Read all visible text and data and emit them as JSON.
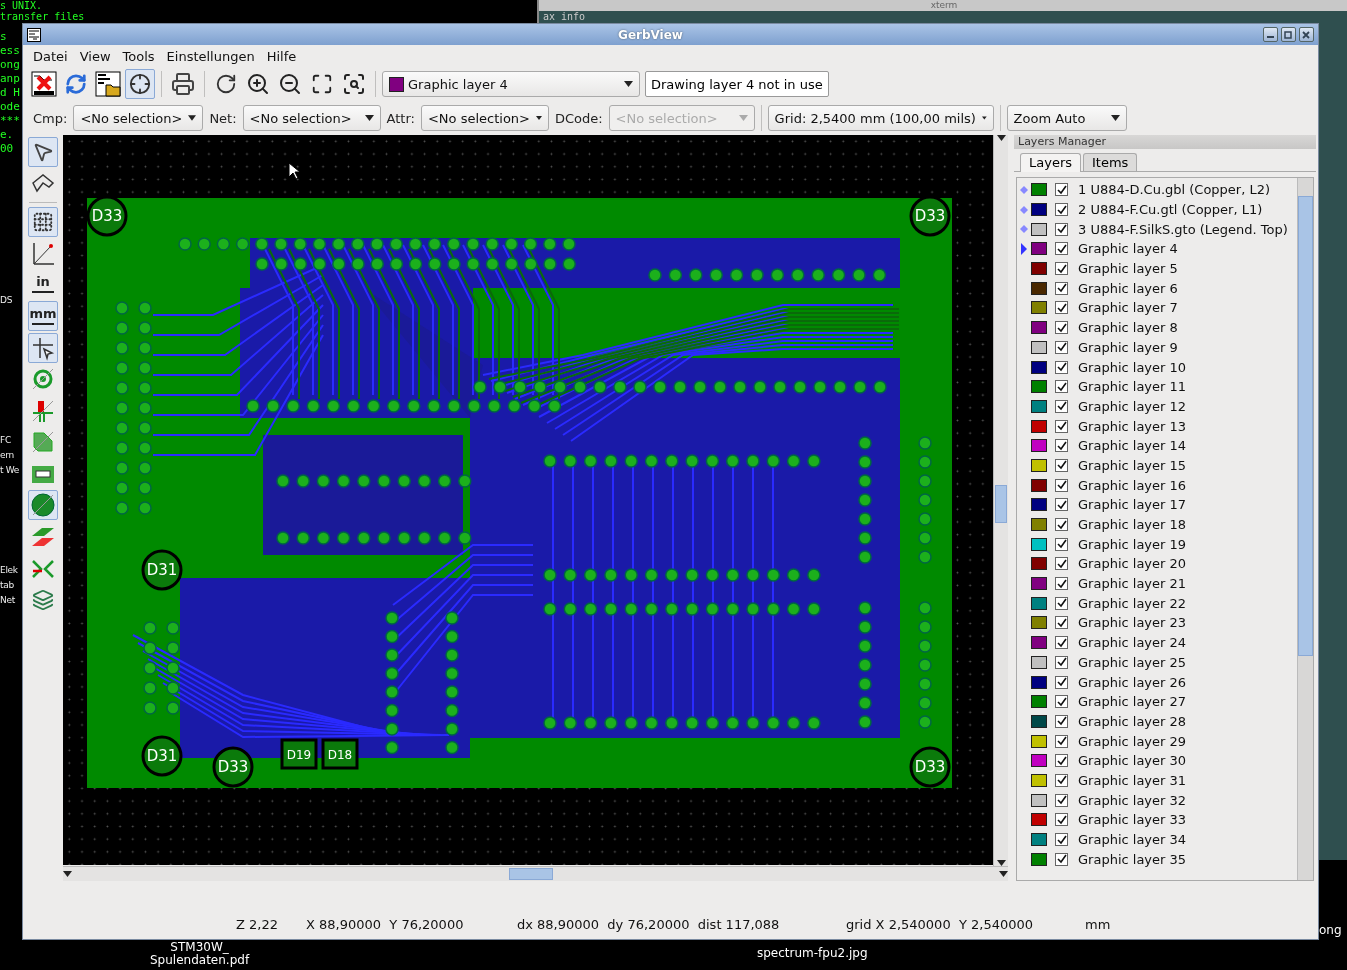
{
  "desktop": {
    "terminal_top": [
      "s UNIX.",
      "transfer files"
    ],
    "terminal_lines": [
      "s",
      "ess",
      "ong",
      "anp",
      "d H",
      "ode",
      "***",
      "e.",
      "00"
    ],
    "side_texts": [
      "DS",
      "FC",
      "ern",
      "t We",
      "Elek",
      "tab",
      "Net"
    ],
    "xterm_title": "xterm",
    "xterm_line": "ax info",
    "icons": [
      {
        "label": "STM30W_",
        "label_2": "Spulendaten.pdf"
      },
      {
        "label": "spectrum-fpu2.jpg"
      }
    ],
    "edge_text": "ong"
  },
  "window": {
    "title": "GerbView"
  },
  "menu": [
    "Datei",
    "View",
    "Tools",
    "Einstellungen",
    "Hilfe"
  ],
  "main_toolbar": {
    "tools": [
      {
        "toggled": false
      },
      {
        "toggled": false
      },
      {
        "toggled": false
      },
      {
        "toggled": true
      },
      {
        "toggled": false
      },
      {
        "toggled": false
      },
      {
        "toggled": false
      },
      {
        "toggled": false
      },
      {
        "toggled": false
      },
      {
        "toggled": false
      }
    ],
    "layer_select": {
      "value": "Graphic layer 4",
      "color": "#800080"
    },
    "layer_status": "Drawing layer 4 not in use"
  },
  "filter_toolbar": {
    "filters": [
      {
        "label": "Cmp:",
        "value": "<No selection>",
        "disabled": false
      },
      {
        "label": "Net:",
        "value": "<No selection>",
        "disabled": false
      },
      {
        "label": "Attr:",
        "value": "<No selection>",
        "disabled": false
      },
      {
        "label": "DCode:",
        "value": "<No selection>",
        "disabled": true
      }
    ],
    "grid": "Grid: 2,5400 mm (100,00 mils)",
    "zoom": "Zoom Auto"
  },
  "left_toolbar": [
    {
      "toggled": true
    },
    {
      "toggled": false
    },
    {
      "toggled": true
    },
    {
      "toggled": false
    },
    {
      "toggled": false,
      "label": "in"
    },
    {
      "toggled": true,
      "label": "mm"
    },
    {
      "toggled": true
    },
    {
      "toggled": false
    },
    {
      "toggled": false
    },
    {
      "toggled": false
    },
    {
      "toggled": false
    },
    {
      "toggled": true
    },
    {
      "toggled": false
    },
    {
      "toggled": false
    },
    {
      "toggled": false
    }
  ],
  "board": {
    "labels": [
      "D33",
      "D33",
      "D31",
      "D31",
      "D19",
      "D18",
      "D33",
      "D33"
    ]
  },
  "layers_manager": {
    "title": "Layers Manager",
    "tabs": [
      {
        "label": "Layers",
        "selected": true
      },
      {
        "label": "Items",
        "selected": false
      }
    ],
    "layers": [
      {
        "name": "1 U884-D.Cu.gbl (Copper, L2)",
        "color": "#008000",
        "checked": true,
        "loaded": true,
        "selected": false
      },
      {
        "name": "2 U884-F.Cu.gtl (Copper, L1)",
        "color": "#000080",
        "checked": true,
        "loaded": true,
        "selected": false
      },
      {
        "name": "3 U884-F.SilkS.gto (Legend. Top)",
        "color": "#c0c0c0",
        "checked": true,
        "loaded": true,
        "selected": false
      },
      {
        "name": "Graphic layer 4",
        "color": "#800080",
        "checked": true,
        "loaded": false,
        "selected": true
      },
      {
        "name": "Graphic layer 5",
        "color": "#800000",
        "checked": true,
        "loaded": false,
        "selected": false
      },
      {
        "name": "Graphic layer 6",
        "color": "#4a2800",
        "checked": true,
        "loaded": false,
        "selected": false
      },
      {
        "name": "Graphic layer 7",
        "color": "#808000",
        "checked": true,
        "loaded": false,
        "selected": false
      },
      {
        "name": "Graphic layer 8",
        "color": "#800080",
        "checked": true,
        "loaded": false,
        "selected": false
      },
      {
        "name": "Graphic layer 9",
        "color": "#c0c0c0",
        "checked": true,
        "loaded": false,
        "selected": false
      },
      {
        "name": "Graphic layer 10",
        "color": "#000080",
        "checked": true,
        "loaded": false,
        "selected": false
      },
      {
        "name": "Graphic layer 11",
        "color": "#008000",
        "checked": true,
        "loaded": false,
        "selected": false
      },
      {
        "name": "Graphic layer 12",
        "color": "#008080",
        "checked": true,
        "loaded": false,
        "selected": false
      },
      {
        "name": "Graphic layer 13",
        "color": "#c00000",
        "checked": true,
        "loaded": false,
        "selected": false
      },
      {
        "name": "Graphic layer 14",
        "color": "#c000c0",
        "checked": true,
        "loaded": false,
        "selected": false
      },
      {
        "name": "Graphic layer 15",
        "color": "#c0c000",
        "checked": true,
        "loaded": false,
        "selected": false
      },
      {
        "name": "Graphic layer 16",
        "color": "#800000",
        "checked": true,
        "loaded": false,
        "selected": false
      },
      {
        "name": "Graphic layer 17",
        "color": "#000080",
        "checked": true,
        "loaded": false,
        "selected": false
      },
      {
        "name": "Graphic layer 18",
        "color": "#808000",
        "checked": true,
        "loaded": false,
        "selected": false
      },
      {
        "name": "Graphic layer 19",
        "color": "#00c0c0",
        "checked": true,
        "loaded": false,
        "selected": false
      },
      {
        "name": "Graphic layer 20",
        "color": "#800000",
        "checked": true,
        "loaded": false,
        "selected": false
      },
      {
        "name": "Graphic layer 21",
        "color": "#800080",
        "checked": true,
        "loaded": false,
        "selected": false
      },
      {
        "name": "Graphic layer 22",
        "color": "#008080",
        "checked": true,
        "loaded": false,
        "selected": false
      },
      {
        "name": "Graphic layer 23",
        "color": "#808000",
        "checked": true,
        "loaded": false,
        "selected": false
      },
      {
        "name": "Graphic layer 24",
        "color": "#800080",
        "checked": true,
        "loaded": false,
        "selected": false
      },
      {
        "name": "Graphic layer 25",
        "color": "#c0c0c0",
        "checked": true,
        "loaded": false,
        "selected": false
      },
      {
        "name": "Graphic layer 26",
        "color": "#000080",
        "checked": true,
        "loaded": false,
        "selected": false
      },
      {
        "name": "Graphic layer 27",
        "color": "#008000",
        "checked": true,
        "loaded": false,
        "selected": false
      },
      {
        "name": "Graphic layer 28",
        "color": "#004848",
        "checked": true,
        "loaded": false,
        "selected": false
      },
      {
        "name": "Graphic layer 29",
        "color": "#c0c000",
        "checked": true,
        "loaded": false,
        "selected": false
      },
      {
        "name": "Graphic layer 30",
        "color": "#c000c0",
        "checked": true,
        "loaded": false,
        "selected": false
      },
      {
        "name": "Graphic layer 31",
        "color": "#c0c000",
        "checked": true,
        "loaded": false,
        "selected": false
      },
      {
        "name": "Graphic layer 32",
        "color": "#c0c0c0",
        "checked": true,
        "loaded": false,
        "selected": false
      },
      {
        "name": "Graphic layer 33",
        "color": "#c00000",
        "checked": true,
        "loaded": false,
        "selected": false
      },
      {
        "name": "Graphic layer 34",
        "color": "#008080",
        "checked": true,
        "loaded": false,
        "selected": false
      },
      {
        "name": "Graphic layer 35",
        "color": "#008000",
        "checked": true,
        "loaded": false,
        "selected": false
      }
    ]
  },
  "status_bar": {
    "zoom": "Z 2,22",
    "position": "X 88,90000  Y 76,20000",
    "delta": "dx 88,90000  dy 76,20000  dist 117,088",
    "grid": "grid X 2,540000  Y 2,540000",
    "units": "mm"
  }
}
